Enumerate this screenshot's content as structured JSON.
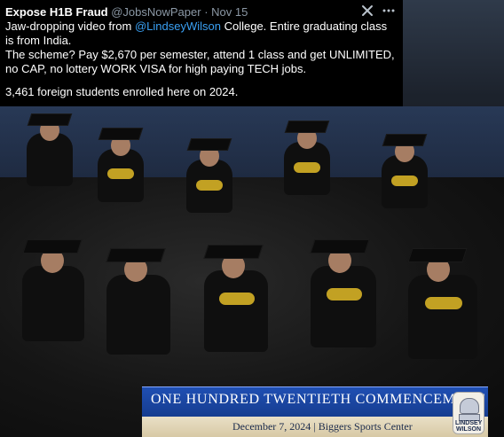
{
  "tweet": {
    "author": "Expose H1B Fraud",
    "handle": "@JobsNowPaper",
    "date": "Nov 15",
    "line1_pre": "Jaw-dropping video from ",
    "mention": "@LindseyWilson",
    "line1_post": " College. Entire graduating class",
    "line2": "is from India.",
    "line3": "The scheme? Pay $2,670 per semester, attend 1 class and get UNLIMITED,",
    "line4": "no CAP, no lottery WORK VISA for high paying TECH jobs.",
    "line5": "3,461 foreign students enrolled here on 2024."
  },
  "commencement": {
    "title": "ONE HUNDRED TWENTIETH COMMENCEMENT",
    "subtitle": "December 7, 2024 | Biggers Sports Center",
    "seal_text": "LINDSEY WILSON"
  },
  "icons": {
    "close": "close-icon",
    "more": "more-icon"
  }
}
